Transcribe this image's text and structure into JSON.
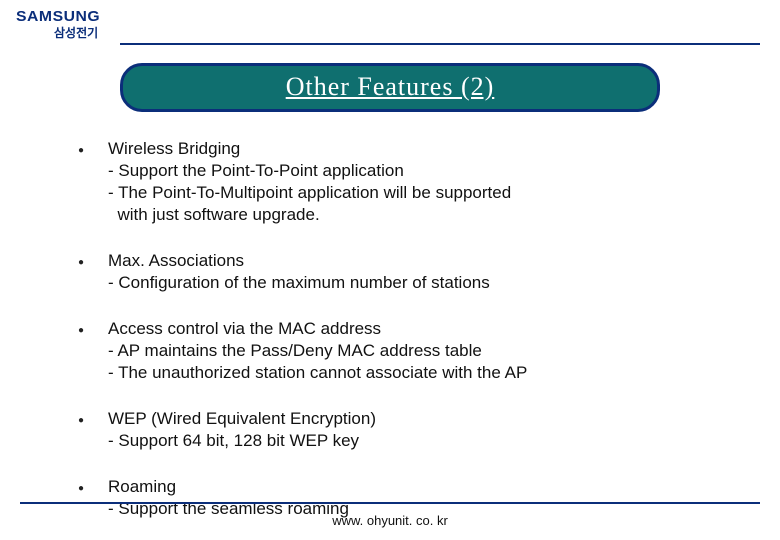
{
  "header": {
    "logo_main": "SAMSUNG",
    "logo_sub": "삼성전기"
  },
  "title": "Other Features (2)",
  "items": [
    {
      "heading": "Wireless Bridging",
      "subs": [
        "- Support the Point-To-Point application",
        "- The Point-To-Multipoint application will be supported",
        "  with just software upgrade."
      ]
    },
    {
      "heading": "Max. Associations",
      "subs": [
        "- Configuration of the maximum number of stations"
      ]
    },
    {
      "heading": "Access control via the MAC address",
      "subs": [
        "- AP maintains the Pass/Deny MAC address table",
        "- The unauthorized station cannot associate with the AP"
      ]
    },
    {
      "heading": "WEP (Wired Equivalent Encryption)",
      "subs": [
        "- Support 64 bit, 128 bit WEP key"
      ]
    },
    {
      "heading": "Roaming",
      "subs": [
        "- Support the seamless roaming"
      ]
    }
  ],
  "footer": "www. ohyunit. co. kr"
}
